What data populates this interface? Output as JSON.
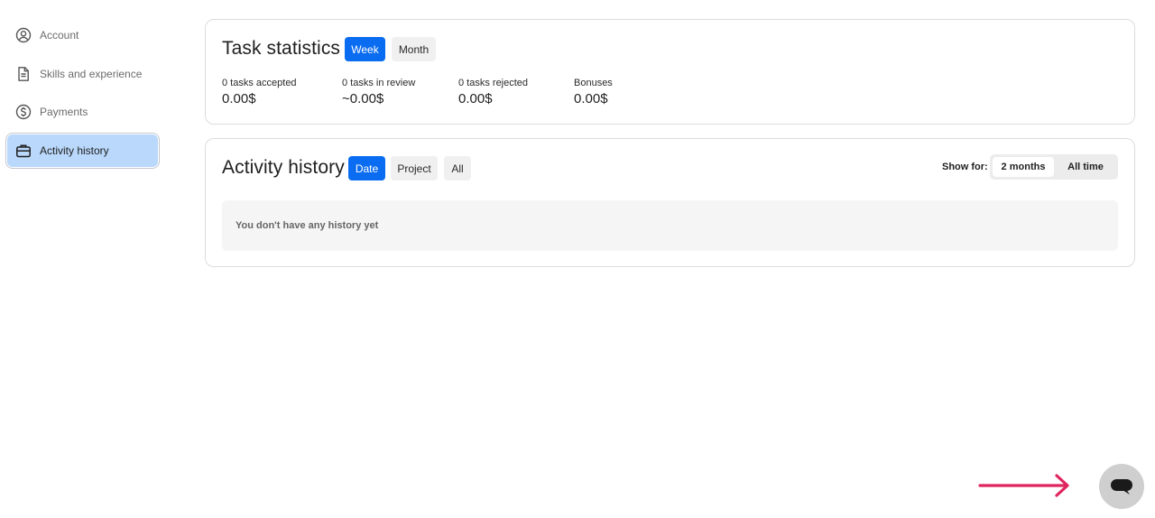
{
  "sidebar": {
    "items": [
      {
        "label": "Account",
        "icon": "user-circle-icon",
        "active": false
      },
      {
        "label": "Skills and experience",
        "icon": "document-icon",
        "active": false
      },
      {
        "label": "Payments",
        "icon": "dollar-circle-icon",
        "active": false
      },
      {
        "label": "Activity history",
        "icon": "briefcase-icon",
        "active": true
      }
    ]
  },
  "task_statistics": {
    "title": "Task statistics",
    "periods": [
      "Week",
      "Month"
    ],
    "selected_period": "Week",
    "stats": [
      {
        "label": "0 tasks accepted",
        "value": "0.00$"
      },
      {
        "label": "0 tasks in review",
        "value": "~0.00$"
      },
      {
        "label": "0 tasks rejected",
        "value": "0.00$"
      },
      {
        "label": "Bonuses",
        "value": "0.00$"
      }
    ]
  },
  "activity_history": {
    "title": "Activity history",
    "groupings": [
      "Date",
      "Project",
      "All"
    ],
    "selected_grouping": "Date",
    "show_for_label": "Show for:",
    "ranges": [
      "2 months",
      "All time"
    ],
    "selected_range": "2 months",
    "empty_message": "You don't have any history yet"
  },
  "colors": {
    "accent": "#0a6cf0",
    "active_nav": "#b9d8fb",
    "hint_arrow": "#e0245e",
    "chat_bubble": "#cfcfcf"
  },
  "floating": {
    "chat_icon": "chat-bubble-icon",
    "arrow_icon": "arrow-right-icon"
  }
}
